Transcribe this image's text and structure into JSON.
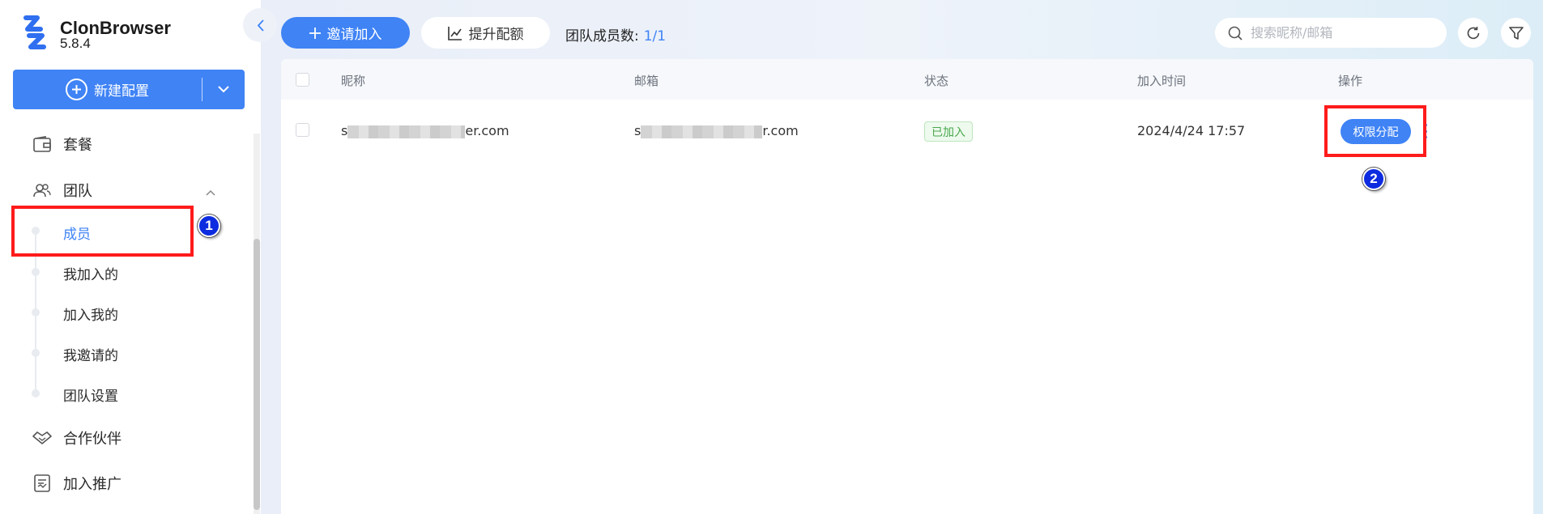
{
  "app": {
    "name": "ClonBrowser",
    "version": "5.8.4"
  },
  "sidebar": {
    "new_config_label": "新建配置",
    "items": {
      "package": "套餐",
      "team": "团队",
      "partner": "合作伙伴",
      "promotion": "加入推广"
    },
    "team_sub": {
      "members": "成员",
      "joined_by_me": "我加入的",
      "joined_mine": "加入我的",
      "invited_by_me": "我邀请的",
      "team_settings": "团队设置"
    }
  },
  "toolbar": {
    "invite_label": "邀请加入",
    "upgrade_label": "提升配额",
    "member_count_label": "团队成员数:",
    "member_count_value": "1/1",
    "search_placeholder": "搜索昵称/邮箱"
  },
  "table": {
    "headers": {
      "nickname": "昵称",
      "email": "邮箱",
      "status": "状态",
      "join_time": "加入时间",
      "actions": "操作"
    },
    "rows": [
      {
        "nickname_prefix": "s",
        "nickname_suffix": "er.com",
        "email_prefix": "s",
        "email_suffix": "r.com",
        "status": "已加入",
        "join_time": "2024/4/24 17:57",
        "action_label": "权限分配"
      }
    ]
  },
  "annotations": {
    "step1": "1",
    "step2": "2"
  },
  "colors": {
    "accent": "#3f83f5",
    "highlight": "#ff1b1b",
    "badge": "#0d2ce0",
    "status_green": "#48a84c"
  }
}
